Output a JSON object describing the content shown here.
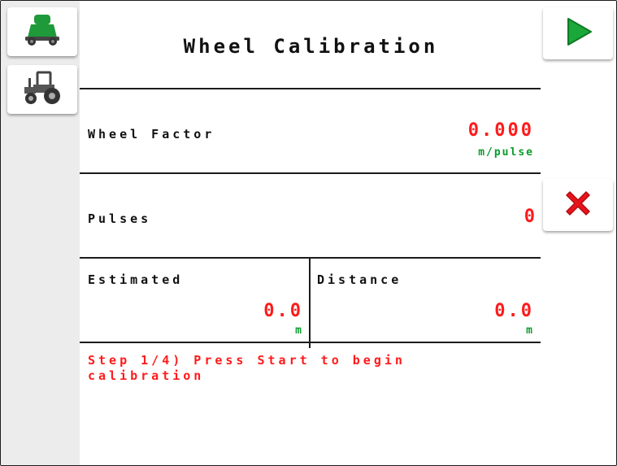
{
  "screen": {
    "title": "Wheel Calibration"
  },
  "sidebar": {
    "items": [
      {
        "icon": "implement-icon"
      },
      {
        "icon": "tractor-icon"
      }
    ]
  },
  "wheel_factor": {
    "label": "Wheel Factor",
    "value": "0.000",
    "unit": "m/pulse"
  },
  "pulses": {
    "label": "Pulses",
    "value": "0"
  },
  "estimated": {
    "label": "Estimated",
    "value": "0.0",
    "unit": "m"
  },
  "distance": {
    "label": "Distance",
    "value": "0.0",
    "unit": "m"
  },
  "status": {
    "step_text": "Step 1/4) Press Start to begin calibration"
  },
  "buttons": {
    "start_icon": "play-icon",
    "cancel_icon": "close-icon"
  },
  "colors": {
    "value_red": "#ff1a1a",
    "unit_green": "#0a9a2c",
    "play_green": "#1aa83a",
    "cancel_red": "#e8141a",
    "sidebar_bg": "#ececec"
  }
}
